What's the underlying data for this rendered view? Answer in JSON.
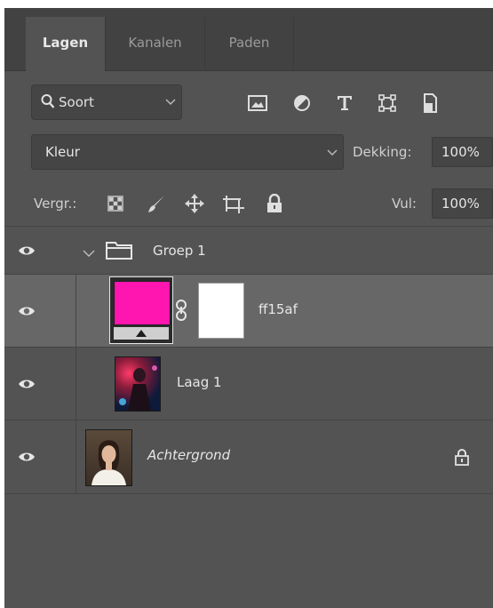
{
  "tabs": [
    {
      "label": "Lagen",
      "active": true
    },
    {
      "label": "Kanalen",
      "active": false
    },
    {
      "label": "Paden",
      "active": false
    }
  ],
  "filter": {
    "kind_label": "Soort",
    "icons": [
      "image-filter-icon",
      "adjustment-filter-icon",
      "type-filter-icon",
      "shape-filter-icon",
      "smart-object-filter-icon"
    ]
  },
  "blend": {
    "mode": "Kleur",
    "opacity_label": "Dekking:",
    "opacity_value": "100%"
  },
  "locks": {
    "label": "Vergr.:",
    "fill_label": "Vul:",
    "fill_value": "100%"
  },
  "layers": [
    {
      "name": "Groep 1",
      "type": "group",
      "expanded": true,
      "visible": true
    },
    {
      "name": "ff15af",
      "type": "fill",
      "color": "#ff15af",
      "selected": true,
      "visible": true
    },
    {
      "name": "Laag 1",
      "type": "pixel",
      "visible": true
    },
    {
      "name": "Achtergrond",
      "type": "background",
      "italic": true,
      "locked": true,
      "visible": true
    }
  ],
  "colors": {
    "panel_bg": "#535353",
    "tabbar_bg": "#424242",
    "selected_row": "#676767",
    "fill_color": "#ff15af"
  }
}
